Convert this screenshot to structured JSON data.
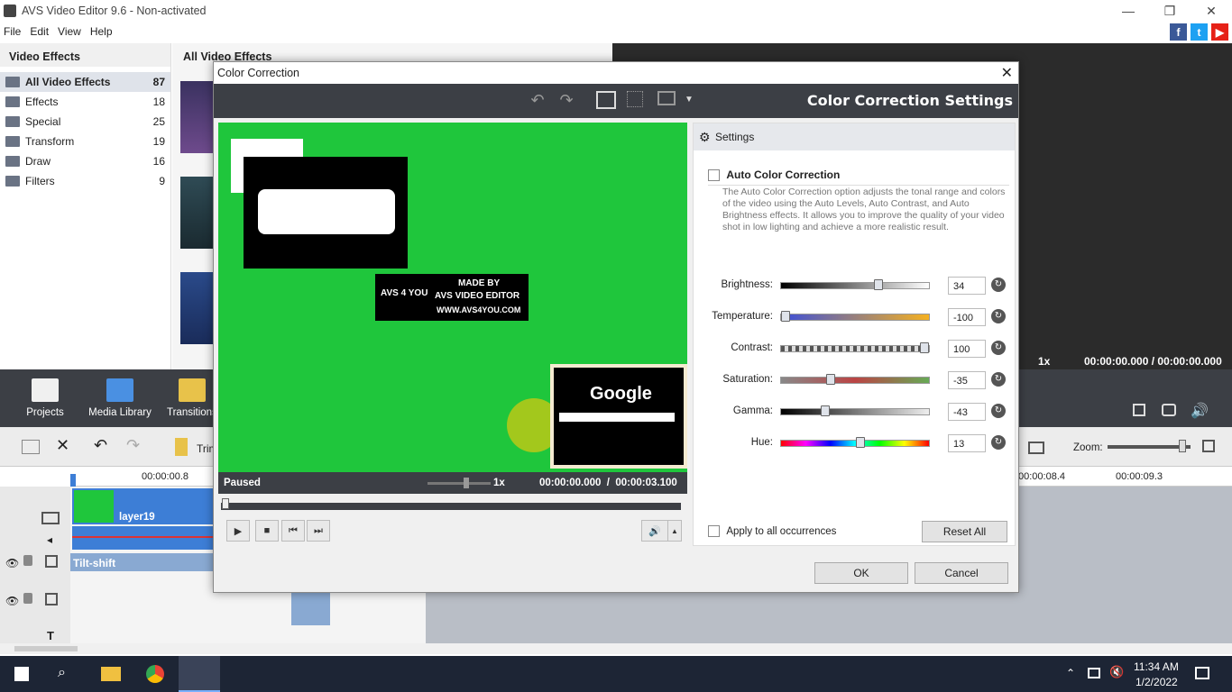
{
  "app": {
    "title": "AVS Video Editor 9.6 - Non-activated"
  },
  "menu": [
    "File",
    "Edit",
    "View",
    "Help"
  ],
  "effects_panel": {
    "header": "Video Effects",
    "items": [
      {
        "label": "All Video Effects",
        "count": "87"
      },
      {
        "label": "Effects",
        "count": "18"
      },
      {
        "label": "Special",
        "count": "25"
      },
      {
        "label": "Transform",
        "count": "19"
      },
      {
        "label": "Draw",
        "count": "16"
      },
      {
        "label": "Filters",
        "count": "9"
      }
    ],
    "grid_header": "All Video Effects"
  },
  "main_preview": {
    "speed": "1x",
    "time": "00:00:00.000 / 00:00:00.000"
  },
  "toolbar": {
    "projects": "Projects",
    "media_library": "Media Library",
    "transitions": "Transitions"
  },
  "timeline": {
    "trim_label": "Trim",
    "zoom_label": "Zoom:",
    "ruler": [
      "00:00:00.8",
      "00:00:08.4",
      "00:00:09.3"
    ],
    "clip_label": "layer19",
    "effect_label": "Tilt-shift"
  },
  "dialog": {
    "title": "Color Correction",
    "header_title": "Color Correction Settings",
    "watermark": {
      "line1": "MADE BY",
      "line2": "AVS VIDEO EDITOR",
      "line3": "WWW.AVS4YOU.COM",
      "logo": "AVS 4 YOU"
    },
    "video_text": "Google",
    "status": "Paused",
    "speed": "1x",
    "time": "00:00:00.000  /  00:00:03.100",
    "settings_header": "Settings",
    "auto_label": "Auto Color Correction",
    "auto_desc": "The Auto Color Correction option adjusts the tonal range and colors of the video using the Auto Levels, Auto Contrast, and Auto Brightness effects. It allows you to improve the quality of your video shot in low lighting and achieve a more realistic result.",
    "sliders": [
      {
        "label": "Brightness:",
        "value": "34",
        "level": 0.67
      },
      {
        "label": "Temperature:",
        "value": "-100",
        "level": 0.0
      },
      {
        "label": "Contrast:",
        "value": "100",
        "level": 1.0
      },
      {
        "label": "Saturation:",
        "value": "-35",
        "level": 0.325
      },
      {
        "label": "Gamma:",
        "value": "-43",
        "level": 0.285
      },
      {
        "label": "Hue:",
        "value": "13",
        "level": 0.54
      }
    ],
    "apply_all": "Apply to all occurrences",
    "reset_all": "Reset All",
    "ok": "OK",
    "cancel": "Cancel"
  },
  "taskbar": {
    "time": "11:34 AM",
    "date": "1/2/2022"
  },
  "colors": {
    "accent": "#3d7ed6",
    "video_bg": "#1fc63c",
    "dark_bar": "#3c3f45"
  }
}
